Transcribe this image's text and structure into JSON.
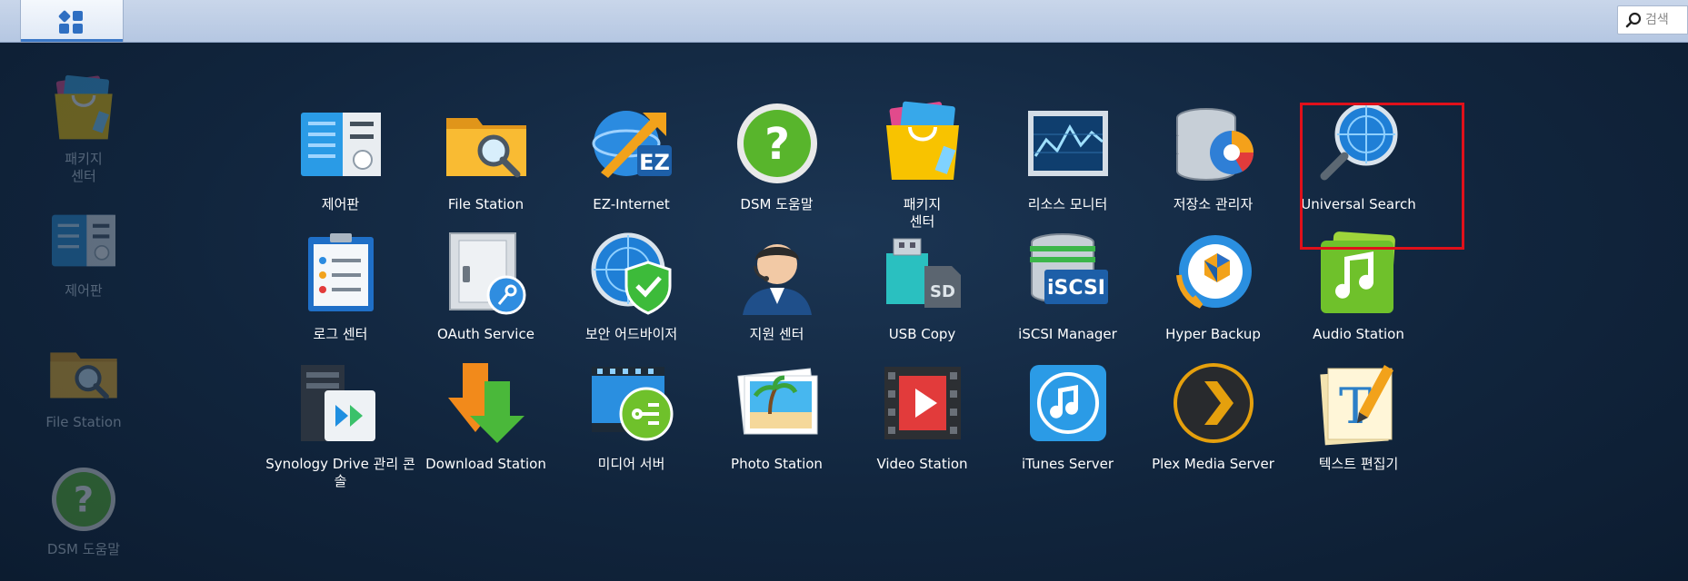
{
  "search": {
    "placeholder": "검색"
  },
  "shortcuts": [
    {
      "label": "패키지\n센터",
      "icon": "package-center-icon"
    },
    {
      "label": "제어판",
      "icon": "control-panel-icon"
    },
    {
      "label": "File Station",
      "icon": "file-station-icon"
    },
    {
      "label": "DSM 도움말",
      "icon": "dsm-help-icon"
    }
  ],
  "apps": [
    {
      "label": "제어판",
      "icon": "control-panel-icon"
    },
    {
      "label": "File Station",
      "icon": "file-station-icon"
    },
    {
      "label": "EZ-Internet",
      "icon": "ez-internet-icon"
    },
    {
      "label": "DSM 도움말",
      "icon": "dsm-help-icon"
    },
    {
      "label": "패키지\n센터",
      "icon": "package-center-icon"
    },
    {
      "label": "리소스 모니터",
      "icon": "resource-monitor-icon"
    },
    {
      "label": "저장소 관리자",
      "icon": "storage-manager-icon"
    },
    {
      "label": "Universal Search",
      "icon": "universal-search-icon"
    },
    {
      "label": "로그 센터",
      "icon": "log-center-icon"
    },
    {
      "label": "OAuth Service",
      "icon": "oauth-service-icon"
    },
    {
      "label": "보안 어드바이저",
      "icon": "security-advisor-icon"
    },
    {
      "label": "지원 센터",
      "icon": "support-center-icon"
    },
    {
      "label": "USB Copy",
      "icon": "usb-copy-icon"
    },
    {
      "label": "iSCSI Manager",
      "icon": "iscsi-manager-icon"
    },
    {
      "label": "Hyper Backup",
      "icon": "hyper-backup-icon"
    },
    {
      "label": "Audio Station",
      "icon": "audio-station-icon"
    },
    {
      "label": "Synology Drive 관리 콘\n솔",
      "icon": "synology-drive-admin-icon"
    },
    {
      "label": "Download Station",
      "icon": "download-station-icon"
    },
    {
      "label": "미디어 서버",
      "icon": "media-server-icon"
    },
    {
      "label": "Photo Station",
      "icon": "photo-station-icon"
    },
    {
      "label": "Video Station",
      "icon": "video-station-icon"
    },
    {
      "label": "iTunes Server",
      "icon": "itunes-server-icon"
    },
    {
      "label": "Plex Media Server",
      "icon": "plex-media-server-icon"
    },
    {
      "label": "텍스트 편집기",
      "icon": "text-editor-icon"
    }
  ],
  "colors": {
    "highlight": "#e0101a",
    "accent": "#3d79c7"
  }
}
